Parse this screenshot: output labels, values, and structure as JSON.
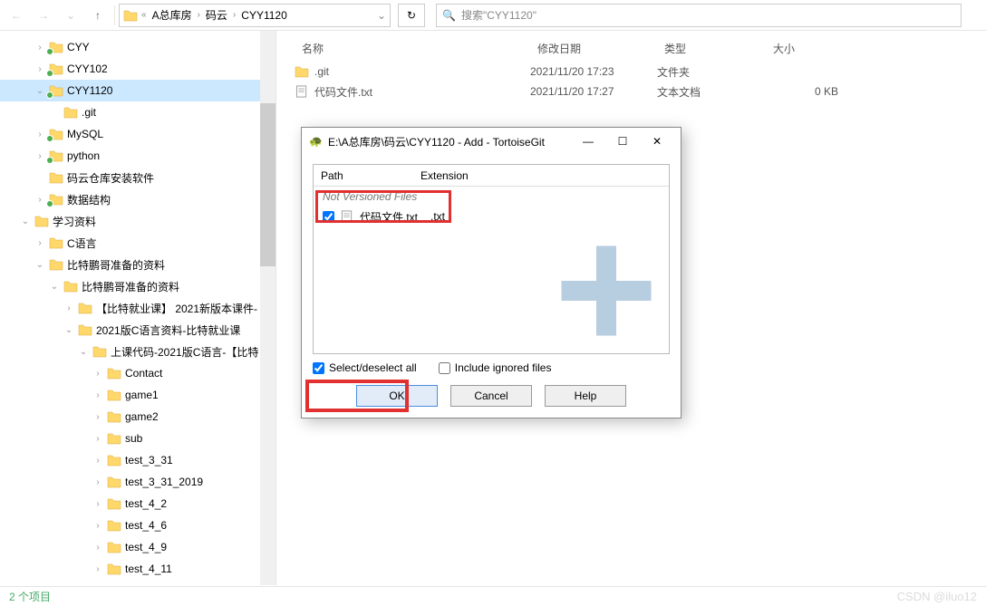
{
  "breadcrumb": {
    "parts": [
      "A总库房",
      "码云",
      "CYY1120"
    ]
  },
  "search": {
    "placeholder": "搜索\"CYY1120\""
  },
  "tree": [
    {
      "indent": 2,
      "chev": "closed",
      "badge": true,
      "label": "CYY"
    },
    {
      "indent": 2,
      "chev": "closed",
      "badge": true,
      "label": "CYY102"
    },
    {
      "indent": 2,
      "chev": "open",
      "badge": true,
      "label": "CYY1120",
      "selected": true
    },
    {
      "indent": 3,
      "chev": "none",
      "badge": false,
      "label": ".git"
    },
    {
      "indent": 2,
      "chev": "closed",
      "badge": true,
      "label": "MySQL"
    },
    {
      "indent": 2,
      "chev": "closed",
      "badge": true,
      "label": "python"
    },
    {
      "indent": 2,
      "chev": "none",
      "badge": false,
      "label": "码云仓库安装软件"
    },
    {
      "indent": 2,
      "chev": "closed",
      "badge": true,
      "label": "数据结构"
    },
    {
      "indent": 1,
      "chev": "open",
      "badge": false,
      "label": "学习资料"
    },
    {
      "indent": 2,
      "chev": "closed",
      "badge": false,
      "label": "C语言"
    },
    {
      "indent": 2,
      "chev": "open",
      "badge": false,
      "label": "比特鹏哥准备的资料"
    },
    {
      "indent": 3,
      "chev": "open",
      "badge": false,
      "label": "比特鹏哥准备的资料"
    },
    {
      "indent": 4,
      "chev": "closed",
      "badge": false,
      "label": "【比特就业课】 2021新版本课件-"
    },
    {
      "indent": 4,
      "chev": "open",
      "badge": false,
      "label": "2021版C语言资料-比特就业课"
    },
    {
      "indent": 5,
      "chev": "open",
      "badge": false,
      "label": "上课代码-2021版C语言-【比特"
    },
    {
      "indent": 6,
      "chev": "closed",
      "badge": false,
      "label": "Contact"
    },
    {
      "indent": 6,
      "chev": "closed",
      "badge": false,
      "label": "game1"
    },
    {
      "indent": 6,
      "chev": "closed",
      "badge": false,
      "label": "game2"
    },
    {
      "indent": 6,
      "chev": "closed",
      "badge": false,
      "label": "sub"
    },
    {
      "indent": 6,
      "chev": "closed",
      "badge": false,
      "label": "test_3_31"
    },
    {
      "indent": 6,
      "chev": "closed",
      "badge": false,
      "label": "test_3_31_2019"
    },
    {
      "indent": 6,
      "chev": "closed",
      "badge": false,
      "label": "test_4_2"
    },
    {
      "indent": 6,
      "chev": "closed",
      "badge": false,
      "label": "test_4_6"
    },
    {
      "indent": 6,
      "chev": "closed",
      "badge": false,
      "label": "test_4_9"
    },
    {
      "indent": 6,
      "chev": "closed",
      "badge": false,
      "label": "test_4_11"
    }
  ],
  "columns": {
    "name": "名称",
    "date": "修改日期",
    "type": "类型",
    "size": "大小"
  },
  "files": [
    {
      "name": ".git",
      "date": "2021/11/20 17:23",
      "type": "文件夹",
      "size": "",
      "icon": "folder"
    },
    {
      "name": "代码文件.txt",
      "date": "2021/11/20 17:27",
      "type": "文本文档",
      "size": "0 KB",
      "icon": "text"
    }
  ],
  "status": {
    "items": "2 个项目"
  },
  "watermark": "CSDN @iluo12",
  "dialog": {
    "title": "E:\\A总库房\\码云\\CYY1120 - Add - TortoiseGit",
    "head": {
      "path": "Path",
      "ext": "Extension"
    },
    "group": "Not Versioned Files",
    "item": {
      "name": "代码文件.txt",
      "ext": ".txt"
    },
    "select_all": "Select/deselect all",
    "include_ignored": "Include ignored files",
    "ok": "OK",
    "cancel": "Cancel",
    "help": "Help"
  }
}
